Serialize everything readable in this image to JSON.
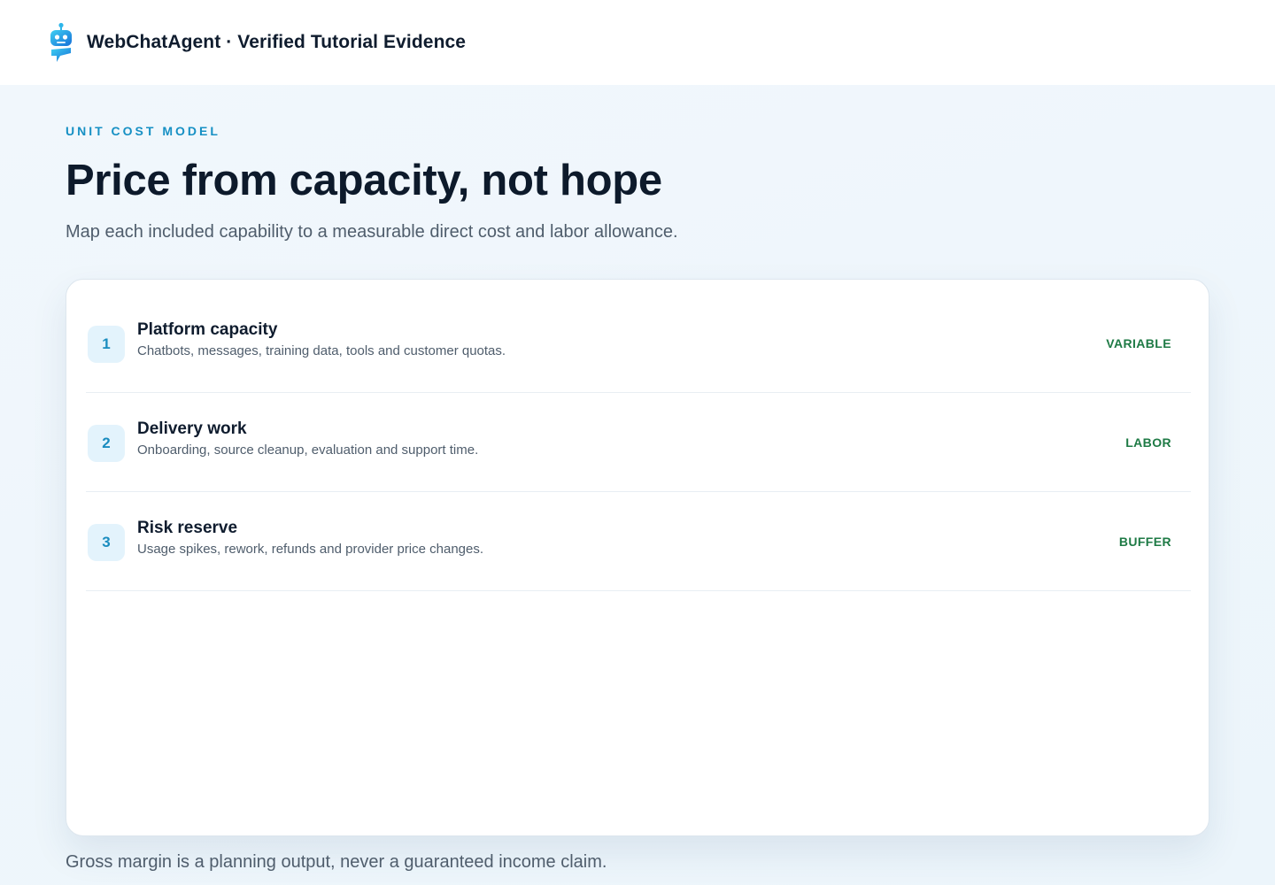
{
  "header": {
    "brand": "WebChatAgent · Verified Tutorial Evidence",
    "logo_icon": "robot-chat-icon",
    "accent_color": "#1e9bd7"
  },
  "hero": {
    "eyebrow": "UNIT COST MODEL",
    "headline": "Price from capacity, not hope",
    "subhead": "Map each included capability to a measurable direct cost and labor allowance."
  },
  "cost_items": [
    {
      "number": "1",
      "title": "Platform capacity",
      "description": "Chatbots, messages, training data, tools and customer quotas.",
      "tag": "VARIABLE"
    },
    {
      "number": "2",
      "title": "Delivery work",
      "description": "Onboarding, source cleanup, evaluation and support time.",
      "tag": "LABOR"
    },
    {
      "number": "3",
      "title": "Risk reserve",
      "description": "Usage spikes, rework, refunds and provider price changes.",
      "tag": "BUFFER"
    }
  ],
  "footnote": "Gross margin is a planning output, never a guaranteed income claim.",
  "colors": {
    "eyebrow": "#1690c4",
    "tag_green": "#1e7a45",
    "number_badge_bg": "#e3f3fc"
  }
}
